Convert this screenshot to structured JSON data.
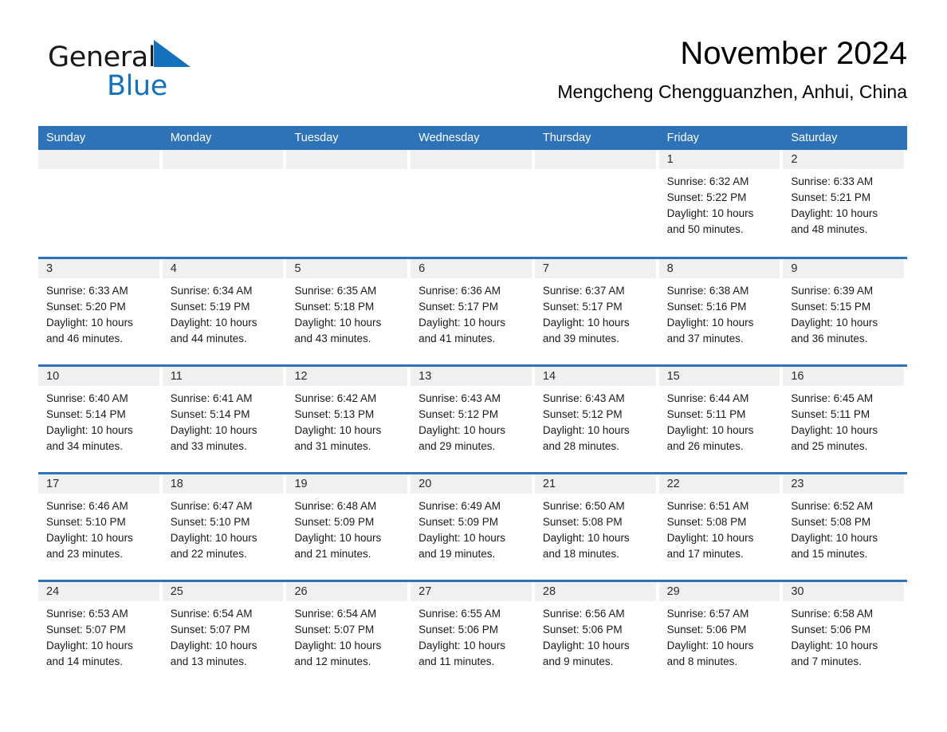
{
  "brand": {
    "word1": "General",
    "word2": "Blue",
    "flag_icon": "triangle-flag-icon",
    "accent_color": "#1471bd"
  },
  "header": {
    "title": "November 2024",
    "location": "Mengcheng Chengguanzhen, Anhui, China"
  },
  "theme": {
    "header_blue": "#2e72b8",
    "day_band_gray": "#f0f0f0",
    "text_black": "#000000"
  },
  "weekdays": [
    "Sunday",
    "Monday",
    "Tuesday",
    "Wednesday",
    "Thursday",
    "Friday",
    "Saturday"
  ],
  "weeks": [
    [
      {
        "day": "",
        "empty": true
      },
      {
        "day": "",
        "empty": true
      },
      {
        "day": "",
        "empty": true
      },
      {
        "day": "",
        "empty": true
      },
      {
        "day": "",
        "empty": true
      },
      {
        "day": "1",
        "sunrise": "Sunrise: 6:32 AM",
        "sunset": "Sunset: 5:22 PM",
        "daylight": "Daylight: 10 hours and 50 minutes."
      },
      {
        "day": "2",
        "sunrise": "Sunrise: 6:33 AM",
        "sunset": "Sunset: 5:21 PM",
        "daylight": "Daylight: 10 hours and 48 minutes."
      }
    ],
    [
      {
        "day": "3",
        "sunrise": "Sunrise: 6:33 AM",
        "sunset": "Sunset: 5:20 PM",
        "daylight": "Daylight: 10 hours and 46 minutes."
      },
      {
        "day": "4",
        "sunrise": "Sunrise: 6:34 AM",
        "sunset": "Sunset: 5:19 PM",
        "daylight": "Daylight: 10 hours and 44 minutes."
      },
      {
        "day": "5",
        "sunrise": "Sunrise: 6:35 AM",
        "sunset": "Sunset: 5:18 PM",
        "daylight": "Daylight: 10 hours and 43 minutes."
      },
      {
        "day": "6",
        "sunrise": "Sunrise: 6:36 AM",
        "sunset": "Sunset: 5:17 PM",
        "daylight": "Daylight: 10 hours and 41 minutes."
      },
      {
        "day": "7",
        "sunrise": "Sunrise: 6:37 AM",
        "sunset": "Sunset: 5:17 PM",
        "daylight": "Daylight: 10 hours and 39 minutes."
      },
      {
        "day": "8",
        "sunrise": "Sunrise: 6:38 AM",
        "sunset": "Sunset: 5:16 PM",
        "daylight": "Daylight: 10 hours and 37 minutes."
      },
      {
        "day": "9",
        "sunrise": "Sunrise: 6:39 AM",
        "sunset": "Sunset: 5:15 PM",
        "daylight": "Daylight: 10 hours and 36 minutes."
      }
    ],
    [
      {
        "day": "10",
        "sunrise": "Sunrise: 6:40 AM",
        "sunset": "Sunset: 5:14 PM",
        "daylight": "Daylight: 10 hours and 34 minutes."
      },
      {
        "day": "11",
        "sunrise": "Sunrise: 6:41 AM",
        "sunset": "Sunset: 5:14 PM",
        "daylight": "Daylight: 10 hours and 33 minutes."
      },
      {
        "day": "12",
        "sunrise": "Sunrise: 6:42 AM",
        "sunset": "Sunset: 5:13 PM",
        "daylight": "Daylight: 10 hours and 31 minutes."
      },
      {
        "day": "13",
        "sunrise": "Sunrise: 6:43 AM",
        "sunset": "Sunset: 5:12 PM",
        "daylight": "Daylight: 10 hours and 29 minutes."
      },
      {
        "day": "14",
        "sunrise": "Sunrise: 6:43 AM",
        "sunset": "Sunset: 5:12 PM",
        "daylight": "Daylight: 10 hours and 28 minutes."
      },
      {
        "day": "15",
        "sunrise": "Sunrise: 6:44 AM",
        "sunset": "Sunset: 5:11 PM",
        "daylight": "Daylight: 10 hours and 26 minutes."
      },
      {
        "day": "16",
        "sunrise": "Sunrise: 6:45 AM",
        "sunset": "Sunset: 5:11 PM",
        "daylight": "Daylight: 10 hours and 25 minutes."
      }
    ],
    [
      {
        "day": "17",
        "sunrise": "Sunrise: 6:46 AM",
        "sunset": "Sunset: 5:10 PM",
        "daylight": "Daylight: 10 hours and 23 minutes."
      },
      {
        "day": "18",
        "sunrise": "Sunrise: 6:47 AM",
        "sunset": "Sunset: 5:10 PM",
        "daylight": "Daylight: 10 hours and 22 minutes."
      },
      {
        "day": "19",
        "sunrise": "Sunrise: 6:48 AM",
        "sunset": "Sunset: 5:09 PM",
        "daylight": "Daylight: 10 hours and 21 minutes."
      },
      {
        "day": "20",
        "sunrise": "Sunrise: 6:49 AM",
        "sunset": "Sunset: 5:09 PM",
        "daylight": "Daylight: 10 hours and 19 minutes."
      },
      {
        "day": "21",
        "sunrise": "Sunrise: 6:50 AM",
        "sunset": "Sunset: 5:08 PM",
        "daylight": "Daylight: 10 hours and 18 minutes."
      },
      {
        "day": "22",
        "sunrise": "Sunrise: 6:51 AM",
        "sunset": "Sunset: 5:08 PM",
        "daylight": "Daylight: 10 hours and 17 minutes."
      },
      {
        "day": "23",
        "sunrise": "Sunrise: 6:52 AM",
        "sunset": "Sunset: 5:08 PM",
        "daylight": "Daylight: 10 hours and 15 minutes."
      }
    ],
    [
      {
        "day": "24",
        "sunrise": "Sunrise: 6:53 AM",
        "sunset": "Sunset: 5:07 PM",
        "daylight": "Daylight: 10 hours and 14 minutes."
      },
      {
        "day": "25",
        "sunrise": "Sunrise: 6:54 AM",
        "sunset": "Sunset: 5:07 PM",
        "daylight": "Daylight: 10 hours and 13 minutes."
      },
      {
        "day": "26",
        "sunrise": "Sunrise: 6:54 AM",
        "sunset": "Sunset: 5:07 PM",
        "daylight": "Daylight: 10 hours and 12 minutes."
      },
      {
        "day": "27",
        "sunrise": "Sunrise: 6:55 AM",
        "sunset": "Sunset: 5:06 PM",
        "daylight": "Daylight: 10 hours and 11 minutes."
      },
      {
        "day": "28",
        "sunrise": "Sunrise: 6:56 AM",
        "sunset": "Sunset: 5:06 PM",
        "daylight": "Daylight: 10 hours and 9 minutes."
      },
      {
        "day": "29",
        "sunrise": "Sunrise: 6:57 AM",
        "sunset": "Sunset: 5:06 PM",
        "daylight": "Daylight: 10 hours and 8 minutes."
      },
      {
        "day": "30",
        "sunrise": "Sunrise: 6:58 AM",
        "sunset": "Sunset: 5:06 PM",
        "daylight": "Daylight: 10 hours and 7 minutes."
      }
    ]
  ]
}
